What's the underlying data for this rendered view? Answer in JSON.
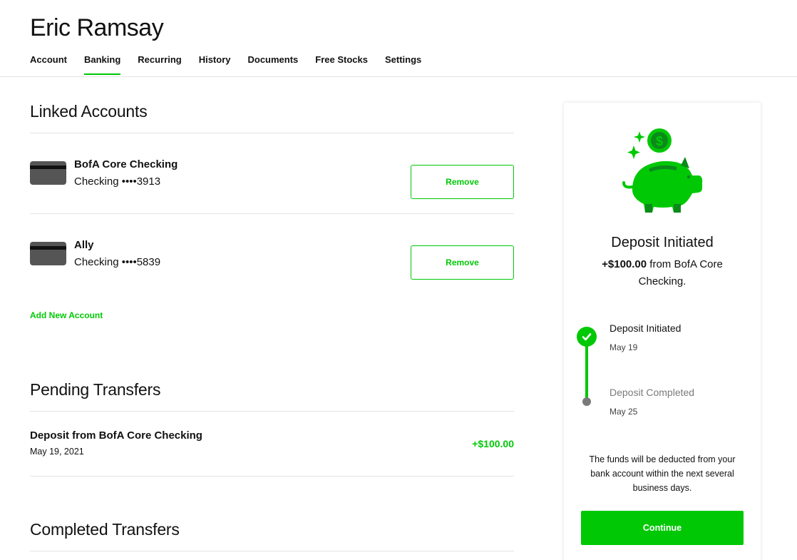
{
  "user": {
    "name": "Eric Ramsay"
  },
  "nav": [
    {
      "label": "Account",
      "active": false
    },
    {
      "label": "Banking",
      "active": true
    },
    {
      "label": "Recurring",
      "active": false
    },
    {
      "label": "History",
      "active": false
    },
    {
      "label": "Documents",
      "active": false
    },
    {
      "label": "Free Stocks",
      "active": false
    },
    {
      "label": "Settings",
      "active": false
    }
  ],
  "linked_accounts": {
    "title": "Linked Accounts",
    "accounts": [
      {
        "name": "BofA Core Checking",
        "detail": "Checking ••••3913",
        "remove_label": "Remove"
      },
      {
        "name": "Ally",
        "detail": "Checking ••••5839",
        "remove_label": "Remove"
      }
    ],
    "add_label": "Add New Account"
  },
  "pending_transfers": {
    "title": "Pending Transfers",
    "items": [
      {
        "title": "Deposit from BofA Core Checking",
        "date": "May 19, 2021",
        "amount": "+$100.00"
      }
    ]
  },
  "completed_transfers": {
    "title": "Completed Transfers"
  },
  "panel": {
    "title": "Deposit Initiated",
    "amount": "+$100.00",
    "sub_rest": " from BofA Core Checking.",
    "steps": [
      {
        "label": "Deposit Initiated",
        "date": "May 19",
        "done": true
      },
      {
        "label": "Deposit Completed",
        "date": "May 25",
        "done": false
      }
    ],
    "note": "The funds will be deducted from your bank account within the next several business days.",
    "continue_label": "Continue"
  },
  "colors": {
    "accent": "#00c805",
    "dark_accent": "#0b8a1a",
    "muted": "#7a7a7a",
    "card": "#555555"
  },
  "icons": [
    "piggy-bank-icon",
    "dollar-coin-icon",
    "sparkle-icon",
    "check-icon",
    "card-icon"
  ]
}
